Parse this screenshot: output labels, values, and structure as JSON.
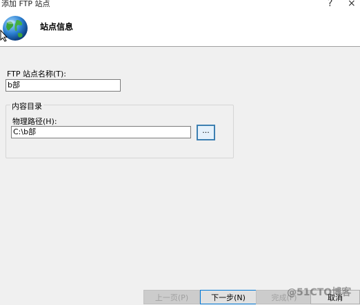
{
  "window": {
    "title": "添加 FTP 站点",
    "help": "?",
    "close": "×"
  },
  "header": {
    "title": "站点信息"
  },
  "site_name": {
    "label": "FTP 站点名称(T):",
    "value": "b部"
  },
  "content_dir": {
    "group_label": "内容目录",
    "path_label": "物理路径(H):",
    "path_value": "C:\\b部",
    "browse_label": "..."
  },
  "footer": {
    "prev_label": "上一页(P)",
    "next_label": "下一步(N)",
    "finish_label": "完成(F)",
    "cancel_label": "取消"
  },
  "watermark": "@51CTO博客"
}
